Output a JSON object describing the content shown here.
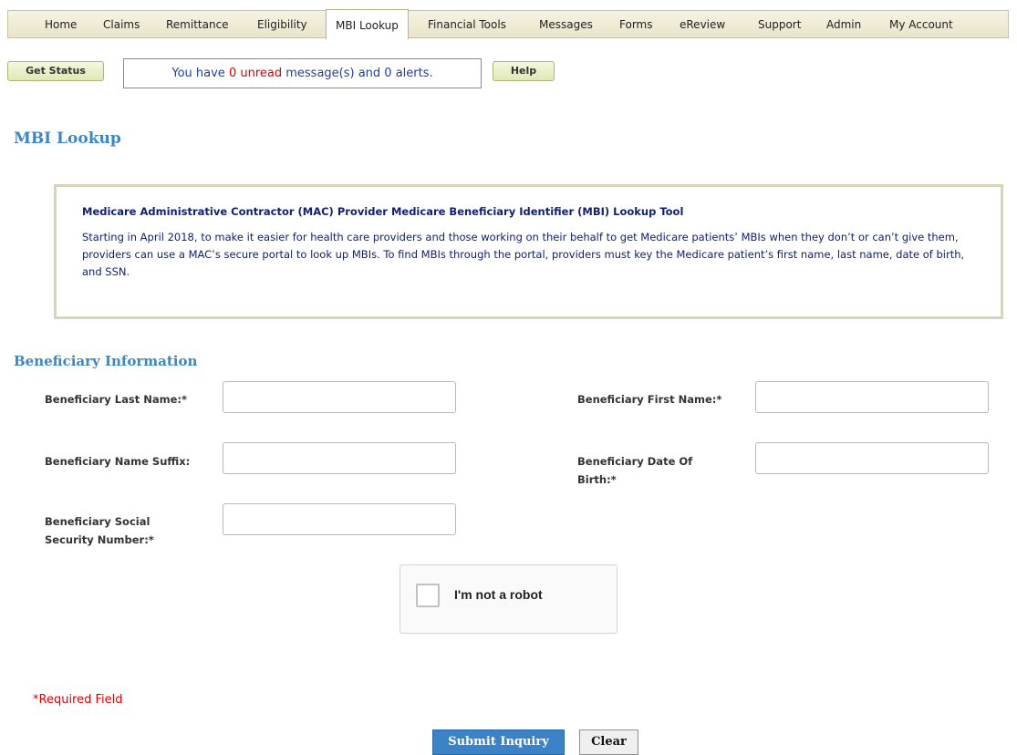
{
  "nav": {
    "items": [
      {
        "label": "Home"
      },
      {
        "label": "Claims"
      },
      {
        "label": "Remittance"
      },
      {
        "label": "Eligibility"
      },
      {
        "label": "MBI Lookup",
        "active": true
      },
      {
        "label": "Financial Tools"
      },
      {
        "label": "Messages"
      },
      {
        "label": "Forms"
      },
      {
        "label": "eReview"
      },
      {
        "label": "Support"
      },
      {
        "label": "Admin"
      },
      {
        "label": "My Account"
      }
    ]
  },
  "toolbar": {
    "get_status_label": "Get Status",
    "help_label": "Help",
    "message": {
      "prefix": "You have ",
      "unread_count": "0",
      "unread_word": " unread",
      "suffix": " message(s) and 0 alerts."
    }
  },
  "page": {
    "title": "MBI Lookup"
  },
  "info": {
    "title": "Medicare Administrative Contractor (MAC) Provider Medicare Beneficiary Identifier (MBI) Lookup Tool",
    "text": "Starting in April 2018, to make it easier for health care providers and those working on their behalf to get Medicare patients’ MBIs when they don’t or can’t give them, providers can use a MAC’s secure portal to look up MBIs. To find MBIs through the portal, providers must key the Medicare patient’s first name, last name, date of birth, and SSN."
  },
  "form": {
    "section_title": "Beneficiary Information",
    "last_name_label": "Beneficiary Last Name:*",
    "first_name_label": "Beneficiary First Name:*",
    "suffix_label": "Beneficiary Name Suffix:",
    "dob_label": "Beneficiary Date Of Birth:*",
    "ssn_label": "Beneficiary Social Security Number:*",
    "last_name_value": "",
    "first_name_value": "",
    "suffix_value": "",
    "dob_value": "",
    "ssn_value": "",
    "captcha_label": "I'm not a robot",
    "required_note": "*Required Field",
    "submit_label": "Submit Inquiry",
    "clear_label": "Clear"
  },
  "colors": {
    "accent": "#3d86c6",
    "required": "#e00000",
    "info_text": "#13206f",
    "nav_bg": "#ece7cf"
  }
}
